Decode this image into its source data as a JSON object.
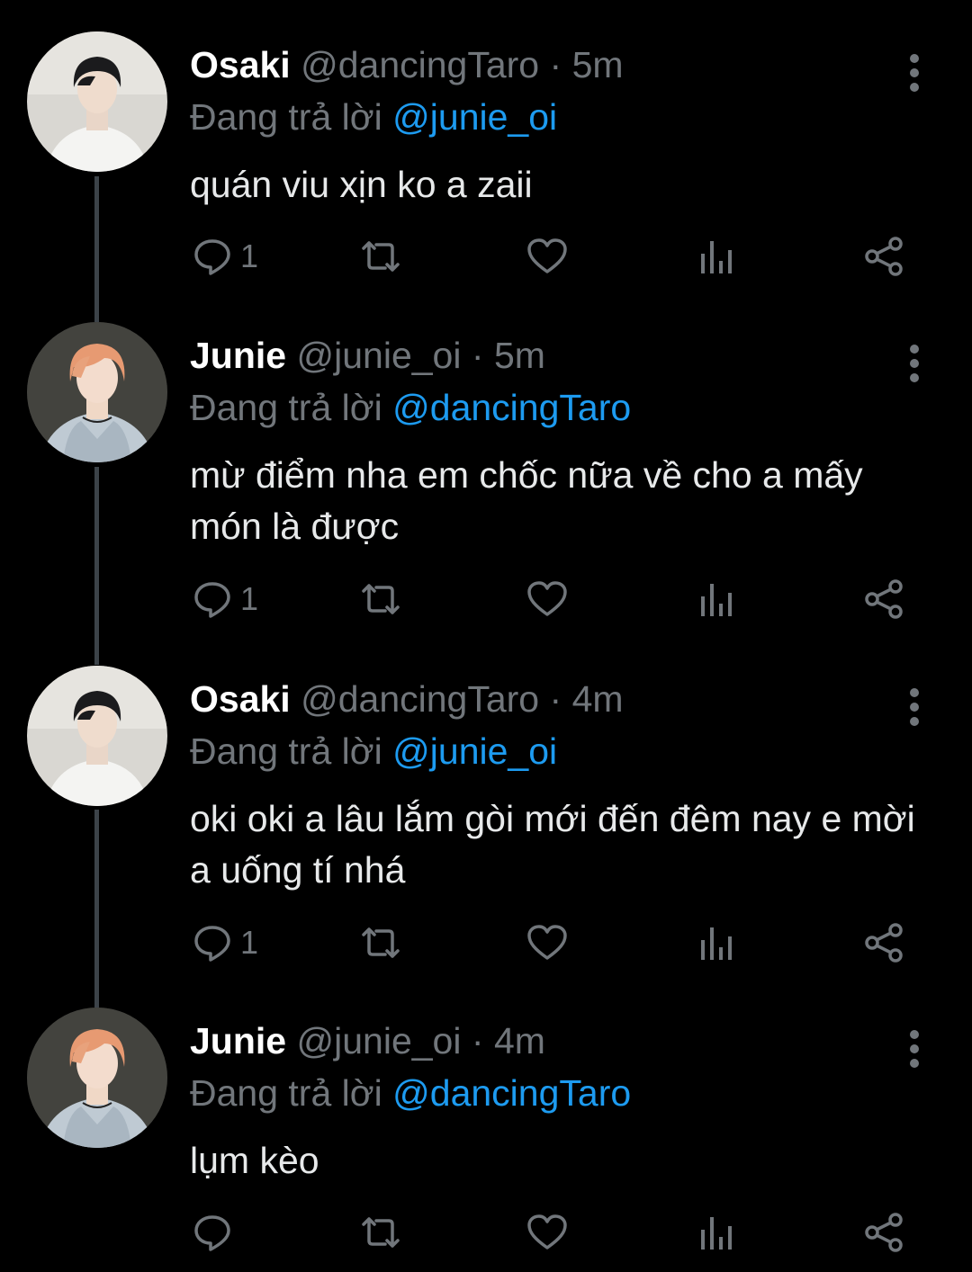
{
  "reply_prefix": "Đang trả lời",
  "colors": {
    "background": "#000000",
    "text": "#e7e9ea",
    "muted": "#71767b",
    "link": "#1d9bf0",
    "thread_line": "#3c4349"
  },
  "icons": {
    "reply": "speech-bubble-icon",
    "retweet": "retweet-icon",
    "like": "heart-icon",
    "views": "bar-chart-icon",
    "share": "share-icon",
    "more": "vertical-dots-icon"
  },
  "tweets": [
    {
      "name": "Osaki",
      "handle": "@dancingTaro",
      "separator": "·",
      "time": "5m",
      "reply_to": "@junie_oi",
      "text": "quán viu xịn ko a zaii",
      "reply_count": "1"
    },
    {
      "name": "Junie",
      "handle": "@junie_oi",
      "separator": "·",
      "time": "5m",
      "reply_to": "@dancingTaro",
      "text": "mừ điểm nha em chốc nữa về cho a mấy món là được",
      "reply_count": "1"
    },
    {
      "name": "Osaki",
      "handle": "@dancingTaro",
      "separator": "·",
      "time": "4m",
      "reply_to": "@junie_oi",
      "text": "oki oki a lâu lắm gòi mới đến đêm nay e mời a uống tí nhá",
      "reply_count": "1"
    },
    {
      "name": "Junie",
      "handle": "@junie_oi",
      "separator": "·",
      "time": "4m",
      "reply_to": "@dancingTaro",
      "text": "lụm kèo",
      "reply_count": ""
    }
  ]
}
